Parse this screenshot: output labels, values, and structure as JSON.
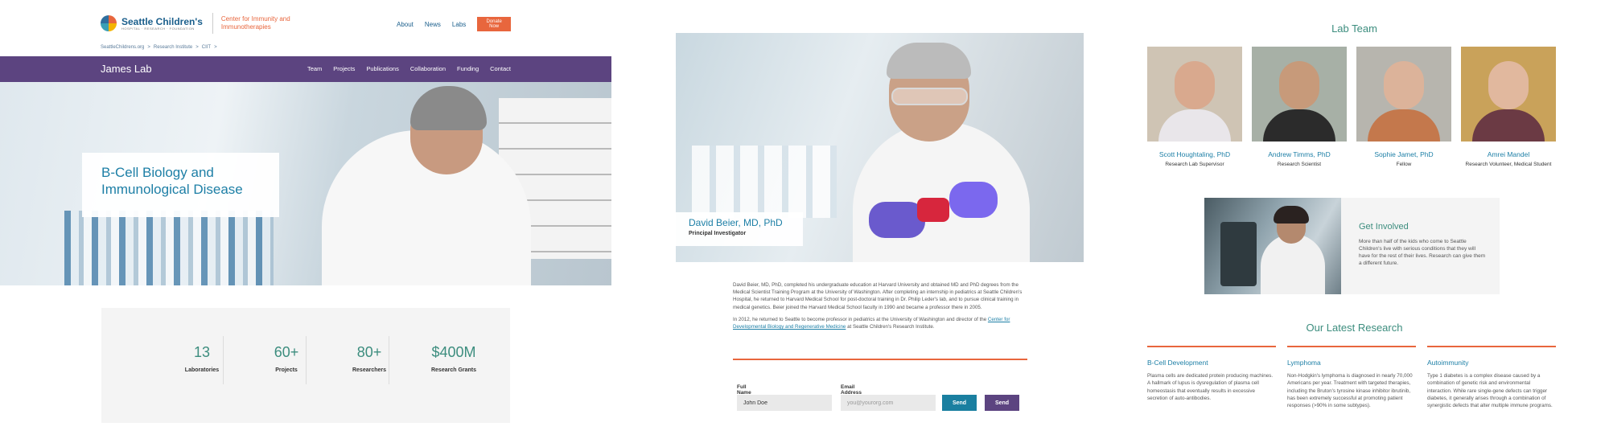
{
  "panel1": {
    "logo": {
      "name": "Seattle Children's",
      "tagline": "HOSPITAL · RESEARCH · FOUNDATION",
      "center_name": "Center for Immunity and Immunotherapies"
    },
    "topnav": [
      "About",
      "News",
      "Labs"
    ],
    "donate_label": "Donate Now",
    "breadcrumb": [
      "SeattleChildrens.org",
      ">",
      "Research Institute",
      ">",
      "CIIT",
      ">"
    ],
    "lab_name": "James Lab",
    "lab_nav": [
      "Team",
      "Projects",
      "Publications",
      "Collaboration",
      "Funding",
      "Contact"
    ],
    "hero_title": "B-Cell Biology and Immunological Disease",
    "stats": [
      {
        "value": "13",
        "label": "Laboratories"
      },
      {
        "value": "60+",
        "label": "Projects"
      },
      {
        "value": "80+",
        "label": "Researchers"
      },
      {
        "value": "$400M",
        "label": "Research Grants"
      }
    ]
  },
  "panel2": {
    "pi_name": "David Beier, MD, PhD",
    "pi_title": "Principal Investigator",
    "bio_p1": "David Beier, MD, PhD, completed his undergraduate education at Harvard University and obtained MD and PhD degrees from the Medical Scientist Training Program at the University of Washington. After completing an internship in pediatrics at Seattle Children's Hospital, he returned to Harvard Medical School for post-doctoral training in Dr. Philip Leder's lab, and to pursue clinical training in medical genetics. Beier joined the Harvard Medical School faculty in 1990 and became a professor there in 2005.",
    "bio_p2_start": "In 2012, he returned to Seattle to become professor in pediatrics at the University of Washington and director of the",
    "bio_p2_link": "Center for Developmental Biology and Regenerative Medicine",
    "bio_p2_end": "at Seattle Children's Research Institute.",
    "form": {
      "name_label": "Full Name",
      "name_value": "John Doe",
      "email_label": "Email Address",
      "email_placeholder": "you@yourorg.com",
      "send_label_1": "Send",
      "send_label_2": "Send"
    }
  },
  "panel3": {
    "team_title": "Lab Team",
    "team": [
      {
        "name": "Scott Houghtaling, PhD",
        "role": "Research Lab Supervisor"
      },
      {
        "name": "Andrew Timms, PhD",
        "role": "Research Scientist"
      },
      {
        "name": "Sophie Jamet, PhD",
        "role": "Fellow"
      },
      {
        "name": "Amrei Mandel",
        "role": "Research Volunteer, Medical Student"
      }
    ],
    "involved_title": "Get Involved",
    "involved_text": "More than half of the kids who come to Seattle Children's live with serious conditions that they will have for the rest of their lives. Research can give them a different future.",
    "research_title": "Our Latest Research",
    "research": [
      {
        "title": "B-Cell Development",
        "text": "Plasma cells are dedicated protein producing machines. A hallmark of lupus is dysregulation of plasma cell homeostasis that eventually results in excessive secretion of auto-antibodies."
      },
      {
        "title": "Lymphoma",
        "text": "Non-Hodgkin's lymphoma is diagnosed in nearly 70,000 Americans per year. Treatment with targeted therapies, including the Bruton's tyrosine kinase inhibitor ibrutinib, has been extremely successful at promoting patient responses (>90% in some subtypes)."
      },
      {
        "title": "Autoimmunity",
        "text": "Type 1 diabetes is a complex disease caused by a combination of genetic risk and environmental interaction. While rare single-gene defects can trigger diabetes, it generally arises through a combination of synergistic defects that alter multiple immune programs."
      }
    ]
  },
  "colors": {
    "purple": "#5c4480",
    "orange": "#e8663d",
    "teal": "#3c8d7e",
    "blue": "#1d7fa6",
    "send_teal": "#1a7fa0",
    "send_purple": "#5c4480"
  }
}
